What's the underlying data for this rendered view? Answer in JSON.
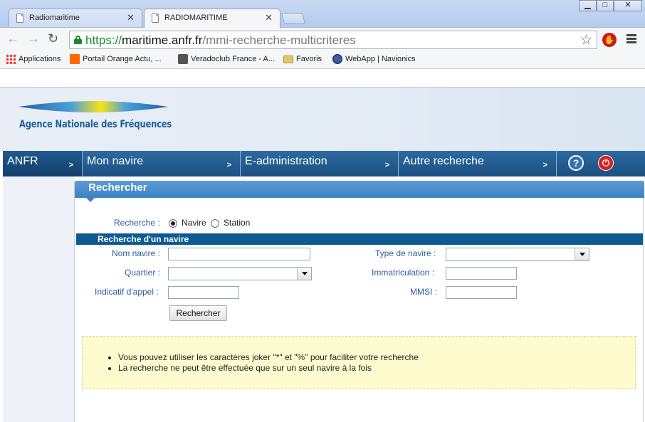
{
  "browser": {
    "tabs": [
      {
        "title": "Radiomaritime",
        "active": false
      },
      {
        "title": "RADIOMARITIME",
        "active": true
      }
    ],
    "url": {
      "protocol": "https://",
      "host": "maritime.anfr.fr",
      "path": "/mmi-recherche-multicriteres"
    },
    "bookmarks": [
      {
        "label": "Applications",
        "icon": "apps-grid-icon"
      },
      {
        "label": "Portail Orange  Actu, ...",
        "icon": "orange-logo-icon"
      },
      {
        "label": "Veradoclub France - A...",
        "icon": "veradoclub-icon"
      },
      {
        "label": "Favoris",
        "icon": "folder-icon"
      },
      {
        "label": "WebApp | Navionics",
        "icon": "globe-icon"
      }
    ]
  },
  "site": {
    "logo_text": "Agence Nationale des Fréquences",
    "nav": [
      {
        "label": "ANFR"
      },
      {
        "label": "Mon navire"
      },
      {
        "label": "E-administration"
      },
      {
        "label": "Autre recherche"
      }
    ],
    "help_icon": "?",
    "power_icon": "power-icon"
  },
  "search": {
    "panel_title": "Rechercher",
    "mode_label": "Recherche :",
    "options": [
      {
        "label": "Navire",
        "selected": true
      },
      {
        "label": "Station",
        "selected": false
      }
    ],
    "section_title": "Recherche d'un navire",
    "fields": {
      "nom_navire": {
        "label": "Nom navire :",
        "value": ""
      },
      "quartier": {
        "label": "Quartier :",
        "value": ""
      },
      "indicatif": {
        "label": "Indicatif d'appel :",
        "value": ""
      },
      "type_navire": {
        "label": "Type de navire :",
        "value": ""
      },
      "immatriculation": {
        "label": "Immatriculation :",
        "value": ""
      },
      "mmsi": {
        "label": "MMSI :",
        "value": ""
      }
    },
    "submit_label": "Rechercher",
    "info": [
      "Vous pouvez utiliser les caractères joker \"*\" et \"%\" pour faciliter votre recherche",
      "La recherche ne peut être effectuée que sur un seul navire à la fois"
    ]
  },
  "colors": {
    "nav_blue": "#1b4f80",
    "panel_blue": "#3e83c4",
    "section_blue": "#0d5a92",
    "label_blue": "#2b5d9e",
    "info_bg": "#fefccf"
  }
}
